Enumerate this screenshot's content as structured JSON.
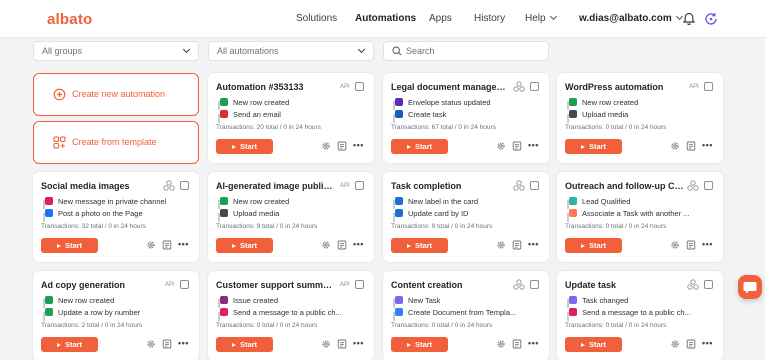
{
  "header": {
    "logo": "albato",
    "nav": [
      {
        "label": "Solutions",
        "active": false
      },
      {
        "label": "Automations",
        "active": true
      },
      {
        "label": "Apps",
        "active": false
      },
      {
        "label": "History",
        "active": false
      },
      {
        "label": "Help",
        "active": false
      }
    ],
    "user": "w.dias@albato.com",
    "icons": [
      "bell-icon",
      "update-icon"
    ]
  },
  "filters": {
    "groups": "All groups",
    "automations": "All automations",
    "search_placeholder": "Search"
  },
  "create": {
    "new": "Create new automation",
    "template": "Create from template"
  },
  "start_label": "Start",
  "cards": [
    {
      "title": "Automation #353133",
      "badge": "API",
      "steps": [
        {
          "text": "New row created",
          "icon": "google-sheets",
          "color": "#1e9e55"
        },
        {
          "text": "Send an email",
          "icon": "gmail",
          "color": "#d93025"
        }
      ],
      "tx": "Transactions: 20 total / 0 in 24 hours"
    },
    {
      "title": "Legal document managem...",
      "badge": "",
      "steps": [
        {
          "text": "Envelope status updated",
          "icon": "docusign",
          "color": "#5b2bb5"
        },
        {
          "text": "Create task",
          "icon": "task-check",
          "color": "#1a5fb4"
        }
      ],
      "tx": "Transactions: 67 total / 0 in 24 hours"
    },
    {
      "title": "WordPress automation",
      "badge": "API",
      "steps": [
        {
          "text": "New row created",
          "icon": "google-sheets",
          "color": "#1e9e55"
        },
        {
          "text": "Upload media",
          "icon": "wordpress",
          "color": "#444a50"
        }
      ],
      "tx": "Transactions: 0 total / 0 in 24 hours"
    },
    {
      "title": "Social media images",
      "badge": "",
      "steps": [
        {
          "text": "New message in private channel",
          "icon": "slack",
          "color": "#e01e5a"
        },
        {
          "text": "Post a photo on the Page",
          "icon": "facebook",
          "color": "#1877f2"
        }
      ],
      "tx": "Transactions: 32 total / 0 in 24 hours"
    },
    {
      "title": "AI-generated image publis...",
      "badge": "API",
      "steps": [
        {
          "text": "New row created",
          "icon": "google-sheets",
          "color": "#1e9e55"
        },
        {
          "text": "Upload media",
          "icon": "wordpress",
          "color": "#444a50"
        }
      ],
      "tx": "Transactions: 9 total / 0 in 24 hours"
    },
    {
      "title": "Task completion",
      "badge": "",
      "steps": [
        {
          "text": "New label in the card",
          "icon": "trello",
          "color": "#1c6fd1"
        },
        {
          "text": "Update card by ID",
          "icon": "trello",
          "color": "#1c6fd1"
        }
      ],
      "tx": "Transactions: 9 total / 0 in 24 hours"
    },
    {
      "title": "Outreach and follow-up Co...",
      "badge": "",
      "steps": [
        {
          "text": "Lead Qualified",
          "icon": "crm",
          "color": "#2bb5a0"
        },
        {
          "text": "Associate a Task with another ...",
          "icon": "hubspot",
          "color": "#ff7a59"
        }
      ],
      "tx": "Transactions: 0 total / 0 in 24 hours"
    },
    {
      "title": "Ad copy generation",
      "badge": "API",
      "steps": [
        {
          "text": "New row created",
          "icon": "google-sheets",
          "color": "#1e9e55"
        },
        {
          "text": "Update a row by number",
          "icon": "google-sheets",
          "color": "#1e9e55"
        }
      ],
      "tx": "Transactions: 2 total / 0 in 24 hours"
    },
    {
      "title": "Customer support summar...",
      "badge": "API",
      "steps": [
        {
          "text": "Issue created",
          "icon": "jira",
          "color": "#8a2c7a"
        },
        {
          "text": "Send a message to a public ch...",
          "icon": "slack",
          "color": "#e01e5a"
        }
      ],
      "tx": "Transactions: 0 total / 0 in 24 hours"
    },
    {
      "title": "Content creation",
      "badge": "",
      "steps": [
        {
          "text": "New Task",
          "icon": "clickup",
          "color": "#7b68ee"
        },
        {
          "text": "Create Document from Templa...",
          "icon": "google-docs",
          "color": "#3a7ff0"
        }
      ],
      "tx": "Transactions: 0 total / 0 in 24 hours"
    },
    {
      "title": "Update task",
      "badge": "",
      "steps": [
        {
          "text": "Task changed",
          "icon": "clickup",
          "color": "#7b68ee"
        },
        {
          "text": "Send a message to a public ch...",
          "icon": "slack",
          "color": "#e01e5a"
        }
      ],
      "tx": "Transactions: 0 total / 0 in 24 hours"
    }
  ],
  "colors": {
    "accent": "#f2603b",
    "background": "#f2f3f5"
  }
}
